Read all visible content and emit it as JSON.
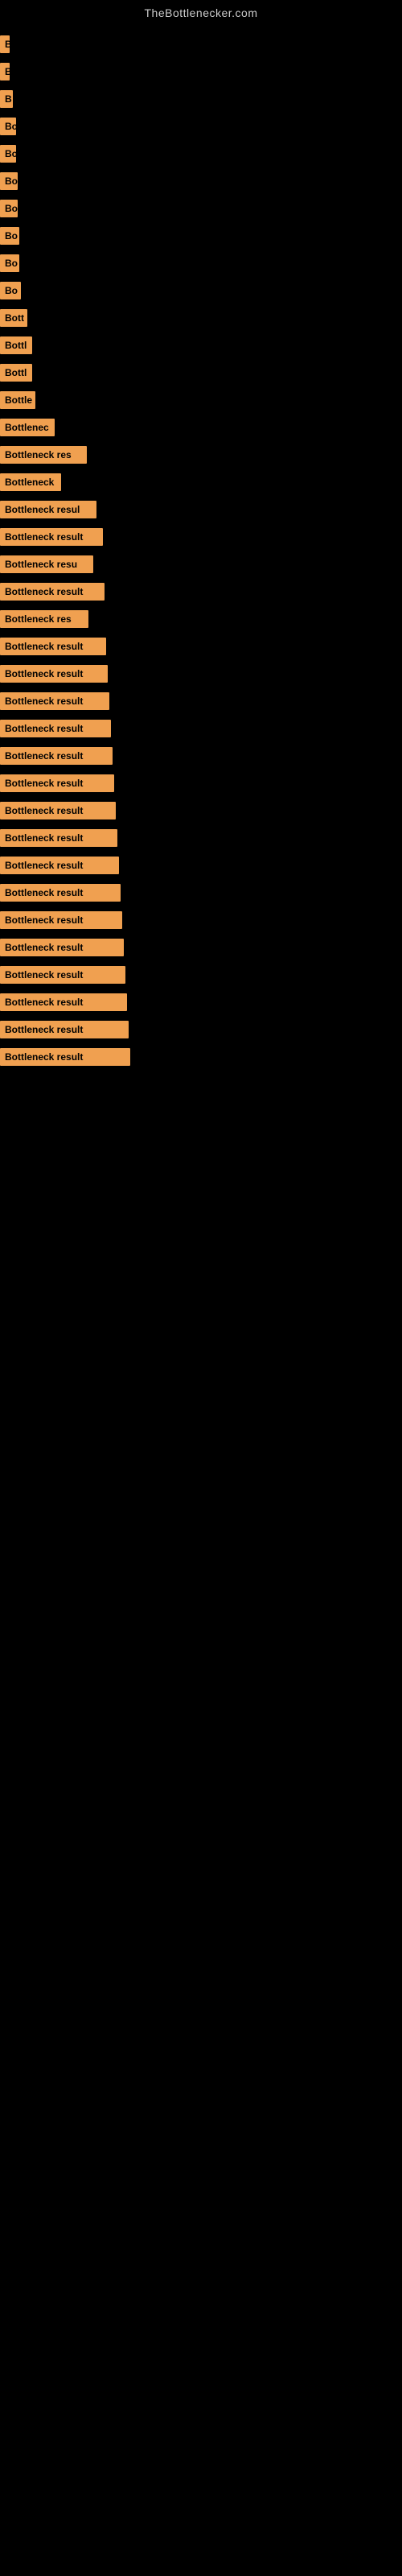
{
  "site": {
    "title": "TheBottlenecker.com"
  },
  "items": [
    {
      "label": "B",
      "width": 12
    },
    {
      "label": "B",
      "width": 12
    },
    {
      "label": "B",
      "width": 16
    },
    {
      "label": "Bo",
      "width": 20
    },
    {
      "label": "Bo",
      "width": 20
    },
    {
      "label": "Bo",
      "width": 22
    },
    {
      "label": "Bo",
      "width": 22
    },
    {
      "label": "Bo",
      "width": 24
    },
    {
      "label": "Bo",
      "width": 24
    },
    {
      "label": "Bo",
      "width": 26
    },
    {
      "label": "Bott",
      "width": 34
    },
    {
      "label": "Bottl",
      "width": 40
    },
    {
      "label": "Bottl",
      "width": 40
    },
    {
      "label": "Bottle",
      "width": 44
    },
    {
      "label": "Bottlenec",
      "width": 68
    },
    {
      "label": "Bottleneck res",
      "width": 108
    },
    {
      "label": "Bottleneck",
      "width": 76
    },
    {
      "label": "Bottleneck resul",
      "width": 120
    },
    {
      "label": "Bottleneck result",
      "width": 128
    },
    {
      "label": "Bottleneck resu",
      "width": 116
    },
    {
      "label": "Bottleneck result",
      "width": 130
    },
    {
      "label": "Bottleneck res",
      "width": 110
    },
    {
      "label": "Bottleneck result",
      "width": 132
    },
    {
      "label": "Bottleneck result",
      "width": 134
    },
    {
      "label": "Bottleneck result",
      "width": 136
    },
    {
      "label": "Bottleneck result",
      "width": 138
    },
    {
      "label": "Bottleneck result",
      "width": 140
    },
    {
      "label": "Bottleneck result",
      "width": 142
    },
    {
      "label": "Bottleneck result",
      "width": 144
    },
    {
      "label": "Bottleneck result",
      "width": 146
    },
    {
      "label": "Bottleneck result",
      "width": 148
    },
    {
      "label": "Bottleneck result",
      "width": 150
    },
    {
      "label": "Bottleneck result",
      "width": 152
    },
    {
      "label": "Bottleneck result",
      "width": 154
    },
    {
      "label": "Bottleneck result",
      "width": 156
    },
    {
      "label": "Bottleneck result",
      "width": 158
    },
    {
      "label": "Bottleneck result",
      "width": 160
    },
    {
      "label": "Bottleneck result",
      "width": 162
    }
  ]
}
